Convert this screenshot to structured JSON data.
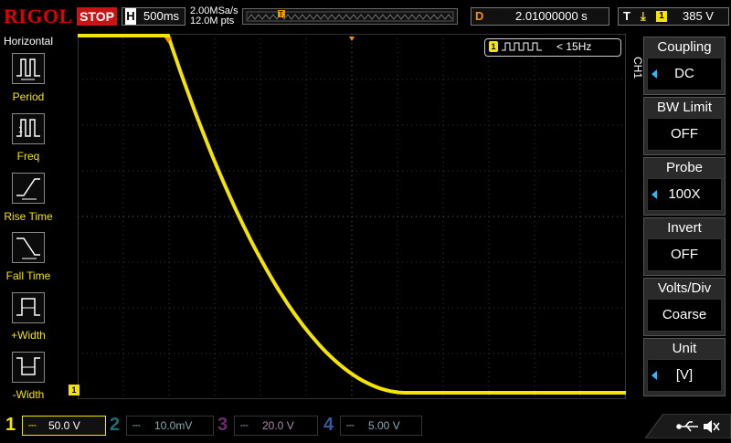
{
  "header": {
    "brand": "RIGOL",
    "run_state": "STOP",
    "horizontal_key": "H",
    "timebase": "500ms",
    "sample_rate": "2.00MSa/s",
    "memory_depth": "12.0M pts",
    "delay_key": "D",
    "delay_value": "2.01000000 s",
    "trigger_key": "T",
    "trigger_channel": "1",
    "trigger_level": "385 V"
  },
  "left_panel": {
    "title": "Horizontal",
    "items": [
      {
        "label": "Period",
        "icon": "period-icon"
      },
      {
        "label": "Freq",
        "icon": "frequency-icon"
      },
      {
        "label": "Rise Time",
        "icon": "rise-time-icon"
      },
      {
        "label": "Fall Time",
        "icon": "fall-time-icon"
      },
      {
        "label": "+Width",
        "icon": "positive-width-icon"
      },
      {
        "label": "-Width",
        "icon": "negative-width-icon"
      }
    ]
  },
  "measurement": {
    "channel": "1",
    "frequency": "< 15Hz"
  },
  "right_panel": {
    "tab": "CH1",
    "menu": [
      {
        "title": "Coupling",
        "value": "DC",
        "has_arrow": true
      },
      {
        "title": "BW Limit",
        "value": "OFF",
        "has_arrow": false
      },
      {
        "title": "Probe",
        "value": "100X",
        "has_arrow": true
      },
      {
        "title": "Invert",
        "value": "OFF",
        "has_arrow": false
      },
      {
        "title": "Volts/Div",
        "value": "Coarse",
        "has_arrow": false
      },
      {
        "title": "Unit",
        "value": "[V]",
        "has_arrow": true
      }
    ]
  },
  "channels": [
    {
      "num": "1",
      "scale": "50.0 V",
      "color": "#f4e400",
      "active": true
    },
    {
      "num": "2",
      "scale": "10.0mV",
      "color": "#00c8c8",
      "active": false
    },
    {
      "num": "3",
      "scale": "20.0 V",
      "color": "#e040e0",
      "active": false
    },
    {
      "num": "4",
      "scale": "5.00 V",
      "color": "#2f7cff",
      "active": false
    }
  ],
  "waveform": {
    "channel": "1",
    "shape": "falling decay from top to bottom then flat",
    "color": "#f4e400"
  },
  "colors": {
    "brand_red": "#e00000",
    "trace_yellow": "#f4e400",
    "trigger_orange": "#f39200",
    "accent_blue": "#2fb4ff"
  }
}
